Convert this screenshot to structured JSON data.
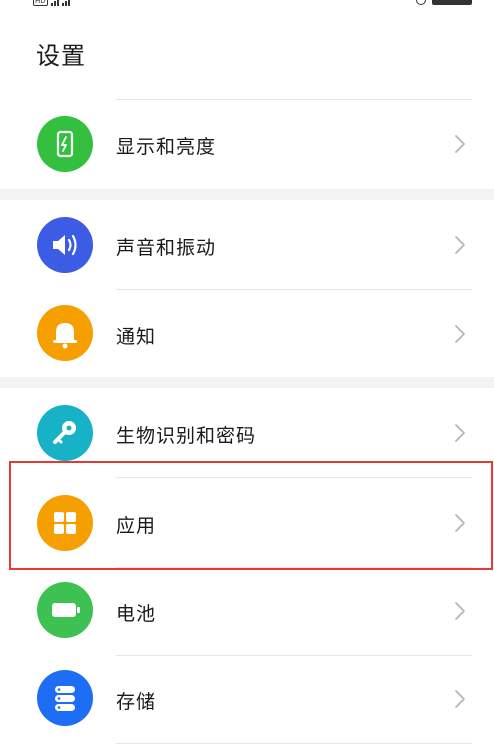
{
  "page": {
    "title": "设置"
  },
  "colors": {
    "display": "#33c03f",
    "sound": "#3d5ce6",
    "notification": "#f5a000",
    "biometrics": "#17b2c8",
    "apps": "#f5a000",
    "battery": "#3ec153",
    "storage": "#1e6ef5",
    "highlight": "#e53935"
  },
  "settings": {
    "display": {
      "label": "显示和亮度",
      "icon": "phone-brightness-icon"
    },
    "sound": {
      "label": "声音和振动",
      "icon": "speaker-icon"
    },
    "notification": {
      "label": "通知",
      "icon": "bell-icon"
    },
    "biometrics": {
      "label": "生物识别和密码",
      "icon": "key-icon"
    },
    "apps": {
      "label": "应用",
      "icon": "app-grid-icon"
    },
    "battery": {
      "label": "电池",
      "icon": "battery-icon"
    },
    "storage": {
      "label": "存储",
      "icon": "storage-icon"
    }
  }
}
